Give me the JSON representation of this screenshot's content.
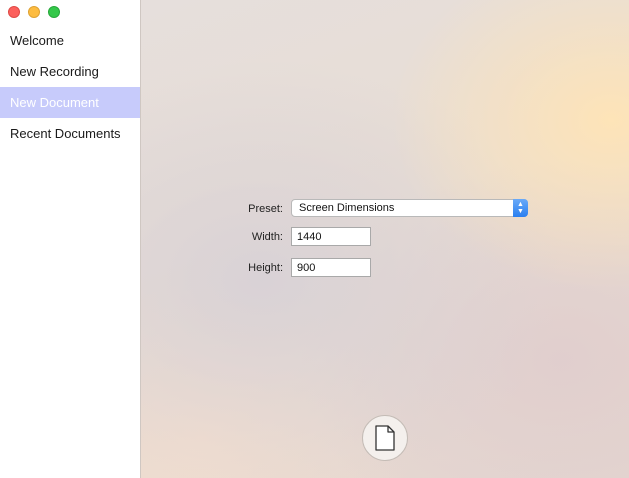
{
  "window": {
    "controls": [
      "close",
      "minimize",
      "zoom"
    ]
  },
  "sidebar": {
    "items": [
      {
        "label": "Welcome",
        "active": false
      },
      {
        "label": "New Recording",
        "active": false
      },
      {
        "label": "New Document",
        "active": true
      },
      {
        "label": "Recent Documents",
        "active": false
      }
    ]
  },
  "form": {
    "preset": {
      "label": "Preset:",
      "value": "Screen Dimensions"
    },
    "width": {
      "label": "Width:",
      "value": "1440"
    },
    "height": {
      "label": "Height:",
      "value": "900"
    }
  },
  "actions": {
    "create_document_icon": "document-icon"
  },
  "colors": {
    "selection": "#c7cbfb",
    "select_accent": "#2a7ff0"
  }
}
